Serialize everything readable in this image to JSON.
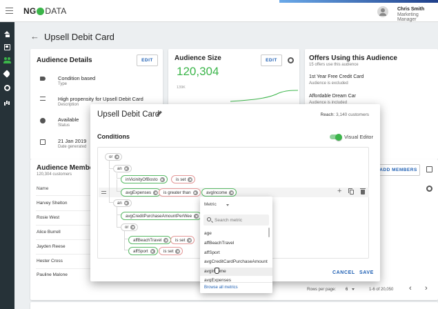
{
  "topbar": {
    "logo_left": "NG",
    "logo_right": "DATA",
    "user_name": "Chris Smith",
    "user_role": "Marketing Manager"
  },
  "page": {
    "title": "Upsell Debit Card",
    "back_icon": "arrow-left-icon"
  },
  "audience_details": {
    "title": "Audience Details",
    "edit_label": "EDIT",
    "items": [
      {
        "label": "Condition based",
        "sub": "Type",
        "icon": "tag-icon"
      },
      {
        "label": "High propensity for Upsell Debit Card",
        "sub": "Description",
        "icon": "notes-icon"
      },
      {
        "label": "Available",
        "sub": "Status",
        "icon": "check-circle-icon"
      },
      {
        "label": "21 Jan 2019",
        "sub": "Date generated",
        "icon": "calendar-icon"
      }
    ]
  },
  "audience_size": {
    "title": "Audience Size",
    "edit_label": "EDIT",
    "value": "120,304",
    "axis_label": "139K"
  },
  "offers": {
    "title": "Offers Using this Audience",
    "subtitle": "15 offers use this audience",
    "items": [
      {
        "title": "1st Year Free Credit Card",
        "sub": "Audience is excluded"
      },
      {
        "title": "Affordable Dream Car",
        "sub": "Audience is included"
      }
    ]
  },
  "members": {
    "title": "Audience Members",
    "subtitle": "120,304 customers",
    "add_label": "ADD MEMBERS",
    "column_name": "Name",
    "rows": [
      "Harvey Shelton",
      "Rosie West",
      "Alice Burrell",
      "Jayden Reese",
      "Hester Cross",
      "Pauline Malone"
    ],
    "rows_per_page_label": "Rows per page:",
    "rows_per_page_value": "6",
    "range": "1-6 of 20,050"
  },
  "dialog": {
    "title": "Upsell Debit Card",
    "reach_label": "Reach:",
    "reach_value": "3,140 customers",
    "conditions_label": "Conditions",
    "visual_editor_label": "Visual Editor",
    "visual_editor_on": true,
    "ops": {
      "root": "or",
      "first": "an",
      "second": "an",
      "nested": "or"
    },
    "chips": {
      "c1": "inVicinityOfBosto",
      "c1_op": "is set",
      "c2_field": "avgExpenses",
      "c2_op": "is greater than",
      "c2_value": "avgIncome",
      "c3": "avgCreditPurchaseAmountPerWee",
      "c4": "affBeachTravel",
      "c4_op": "is set",
      "c5": "affSport",
      "c5_op": "is set"
    },
    "cancel_label": "CANCEL",
    "save_label": "SAVE"
  },
  "dropdown": {
    "selected": "Metric",
    "search_placeholder": "Search metric",
    "options": [
      "age",
      "affBeachTravel",
      "affSport",
      "avgCreditCardPurchaseAmount",
      "avgIncome",
      "avgExpenses"
    ],
    "highlighted": "avgIncome",
    "browse_label": "Browse all metrics"
  },
  "colors": {
    "accent_green": "#3bb54a",
    "link_blue": "#1e5fb3",
    "nav_dark": "#263238"
  }
}
